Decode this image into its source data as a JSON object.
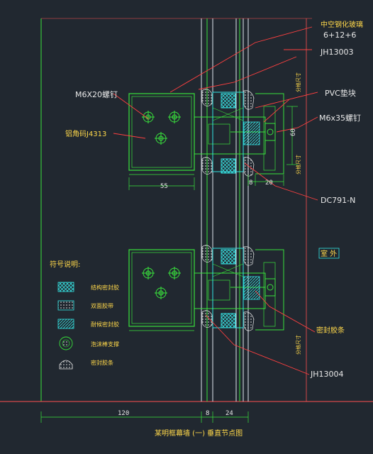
{
  "labels": {
    "glass_type": "中空钢化玻璃",
    "glass_spec": "6+12+6",
    "profile_top": "JH13003",
    "screw_top": "M6X20螺钉",
    "pvc": "PVC垫块",
    "screw_m6x35": "M6x35螺钉",
    "aluminum_angle": "铝角码J4313",
    "profile_dc": "DC791-N",
    "outdoor": "室 外",
    "sealant": "密封胶条",
    "profile_bottom": "JH13004",
    "title": "某明框幕墙 (一) 垂直节点图"
  },
  "vertical_notes": {
    "top_right": "分格尺寸",
    "mid_right": "分格尺寸",
    "bottom_right": "分格尺寸"
  },
  "dimensions": {
    "d55": "55",
    "d60": "60",
    "d8": "8",
    "d20": "20",
    "d120": "120",
    "d8b": "8",
    "d24": "24"
  },
  "legend": {
    "title": "符号说明:",
    "items": [
      {
        "label": "结构密封胶"
      },
      {
        "label": "双面胶带"
      },
      {
        "label": "耐候密封胶"
      },
      {
        "label": "泡沫棒支撑"
      },
      {
        "label": "密封胶条"
      }
    ]
  },
  "colors": {
    "background": "#212830",
    "profile": "#39e23c",
    "glass": "#dfe6ee",
    "glass_edge": "#33e5e5",
    "leader": "#ff3838",
    "annotation": "#ffd84a",
    "text": "#e8e8e8",
    "extension": "#ff4f4f"
  }
}
